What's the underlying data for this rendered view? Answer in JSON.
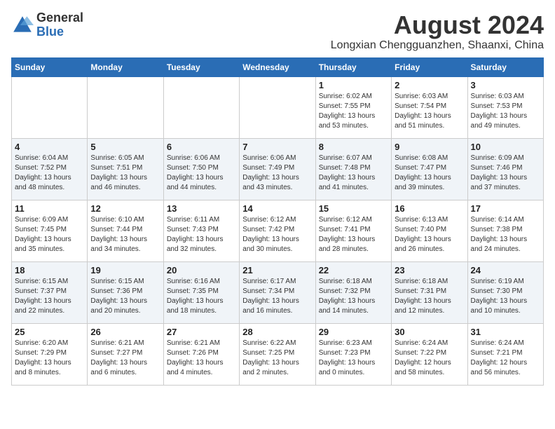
{
  "header": {
    "logo_general": "General",
    "logo_blue": "Blue",
    "main_title": "August 2024",
    "subtitle": "Longxian Chengguanzhen, Shaanxi, China"
  },
  "calendar": {
    "days_of_week": [
      "Sunday",
      "Monday",
      "Tuesday",
      "Wednesday",
      "Thursday",
      "Friday",
      "Saturday"
    ],
    "weeks": [
      [
        {
          "date": "",
          "info": ""
        },
        {
          "date": "",
          "info": ""
        },
        {
          "date": "",
          "info": ""
        },
        {
          "date": "",
          "info": ""
        },
        {
          "date": "1",
          "info": "Sunrise: 6:02 AM\nSunset: 7:55 PM\nDaylight: 13 hours\nand 53 minutes."
        },
        {
          "date": "2",
          "info": "Sunrise: 6:03 AM\nSunset: 7:54 PM\nDaylight: 13 hours\nand 51 minutes."
        },
        {
          "date": "3",
          "info": "Sunrise: 6:03 AM\nSunset: 7:53 PM\nDaylight: 13 hours\nand 49 minutes."
        }
      ],
      [
        {
          "date": "4",
          "info": "Sunrise: 6:04 AM\nSunset: 7:52 PM\nDaylight: 13 hours\nand 48 minutes."
        },
        {
          "date": "5",
          "info": "Sunrise: 6:05 AM\nSunset: 7:51 PM\nDaylight: 13 hours\nand 46 minutes."
        },
        {
          "date": "6",
          "info": "Sunrise: 6:06 AM\nSunset: 7:50 PM\nDaylight: 13 hours\nand 44 minutes."
        },
        {
          "date": "7",
          "info": "Sunrise: 6:06 AM\nSunset: 7:49 PM\nDaylight: 13 hours\nand 43 minutes."
        },
        {
          "date": "8",
          "info": "Sunrise: 6:07 AM\nSunset: 7:48 PM\nDaylight: 13 hours\nand 41 minutes."
        },
        {
          "date": "9",
          "info": "Sunrise: 6:08 AM\nSunset: 7:47 PM\nDaylight: 13 hours\nand 39 minutes."
        },
        {
          "date": "10",
          "info": "Sunrise: 6:09 AM\nSunset: 7:46 PM\nDaylight: 13 hours\nand 37 minutes."
        }
      ],
      [
        {
          "date": "11",
          "info": "Sunrise: 6:09 AM\nSunset: 7:45 PM\nDaylight: 13 hours\nand 35 minutes."
        },
        {
          "date": "12",
          "info": "Sunrise: 6:10 AM\nSunset: 7:44 PM\nDaylight: 13 hours\nand 34 minutes."
        },
        {
          "date": "13",
          "info": "Sunrise: 6:11 AM\nSunset: 7:43 PM\nDaylight: 13 hours\nand 32 minutes."
        },
        {
          "date": "14",
          "info": "Sunrise: 6:12 AM\nSunset: 7:42 PM\nDaylight: 13 hours\nand 30 minutes."
        },
        {
          "date": "15",
          "info": "Sunrise: 6:12 AM\nSunset: 7:41 PM\nDaylight: 13 hours\nand 28 minutes."
        },
        {
          "date": "16",
          "info": "Sunrise: 6:13 AM\nSunset: 7:40 PM\nDaylight: 13 hours\nand 26 minutes."
        },
        {
          "date": "17",
          "info": "Sunrise: 6:14 AM\nSunset: 7:38 PM\nDaylight: 13 hours\nand 24 minutes."
        }
      ],
      [
        {
          "date": "18",
          "info": "Sunrise: 6:15 AM\nSunset: 7:37 PM\nDaylight: 13 hours\nand 22 minutes."
        },
        {
          "date": "19",
          "info": "Sunrise: 6:15 AM\nSunset: 7:36 PM\nDaylight: 13 hours\nand 20 minutes."
        },
        {
          "date": "20",
          "info": "Sunrise: 6:16 AM\nSunset: 7:35 PM\nDaylight: 13 hours\nand 18 minutes."
        },
        {
          "date": "21",
          "info": "Sunrise: 6:17 AM\nSunset: 7:34 PM\nDaylight: 13 hours\nand 16 minutes."
        },
        {
          "date": "22",
          "info": "Sunrise: 6:18 AM\nSunset: 7:32 PM\nDaylight: 13 hours\nand 14 minutes."
        },
        {
          "date": "23",
          "info": "Sunrise: 6:18 AM\nSunset: 7:31 PM\nDaylight: 13 hours\nand 12 minutes."
        },
        {
          "date": "24",
          "info": "Sunrise: 6:19 AM\nSunset: 7:30 PM\nDaylight: 13 hours\nand 10 minutes."
        }
      ],
      [
        {
          "date": "25",
          "info": "Sunrise: 6:20 AM\nSunset: 7:29 PM\nDaylight: 13 hours\nand 8 minutes."
        },
        {
          "date": "26",
          "info": "Sunrise: 6:21 AM\nSunset: 7:27 PM\nDaylight: 13 hours\nand 6 minutes."
        },
        {
          "date": "27",
          "info": "Sunrise: 6:21 AM\nSunset: 7:26 PM\nDaylight: 13 hours\nand 4 minutes."
        },
        {
          "date": "28",
          "info": "Sunrise: 6:22 AM\nSunset: 7:25 PM\nDaylight: 13 hours\nand 2 minutes."
        },
        {
          "date": "29",
          "info": "Sunrise: 6:23 AM\nSunset: 7:23 PM\nDaylight: 13 hours\nand 0 minutes."
        },
        {
          "date": "30",
          "info": "Sunrise: 6:24 AM\nSunset: 7:22 PM\nDaylight: 12 hours\nand 58 minutes."
        },
        {
          "date": "31",
          "info": "Sunrise: 6:24 AM\nSunset: 7:21 PM\nDaylight: 12 hours\nand 56 minutes."
        }
      ]
    ]
  }
}
